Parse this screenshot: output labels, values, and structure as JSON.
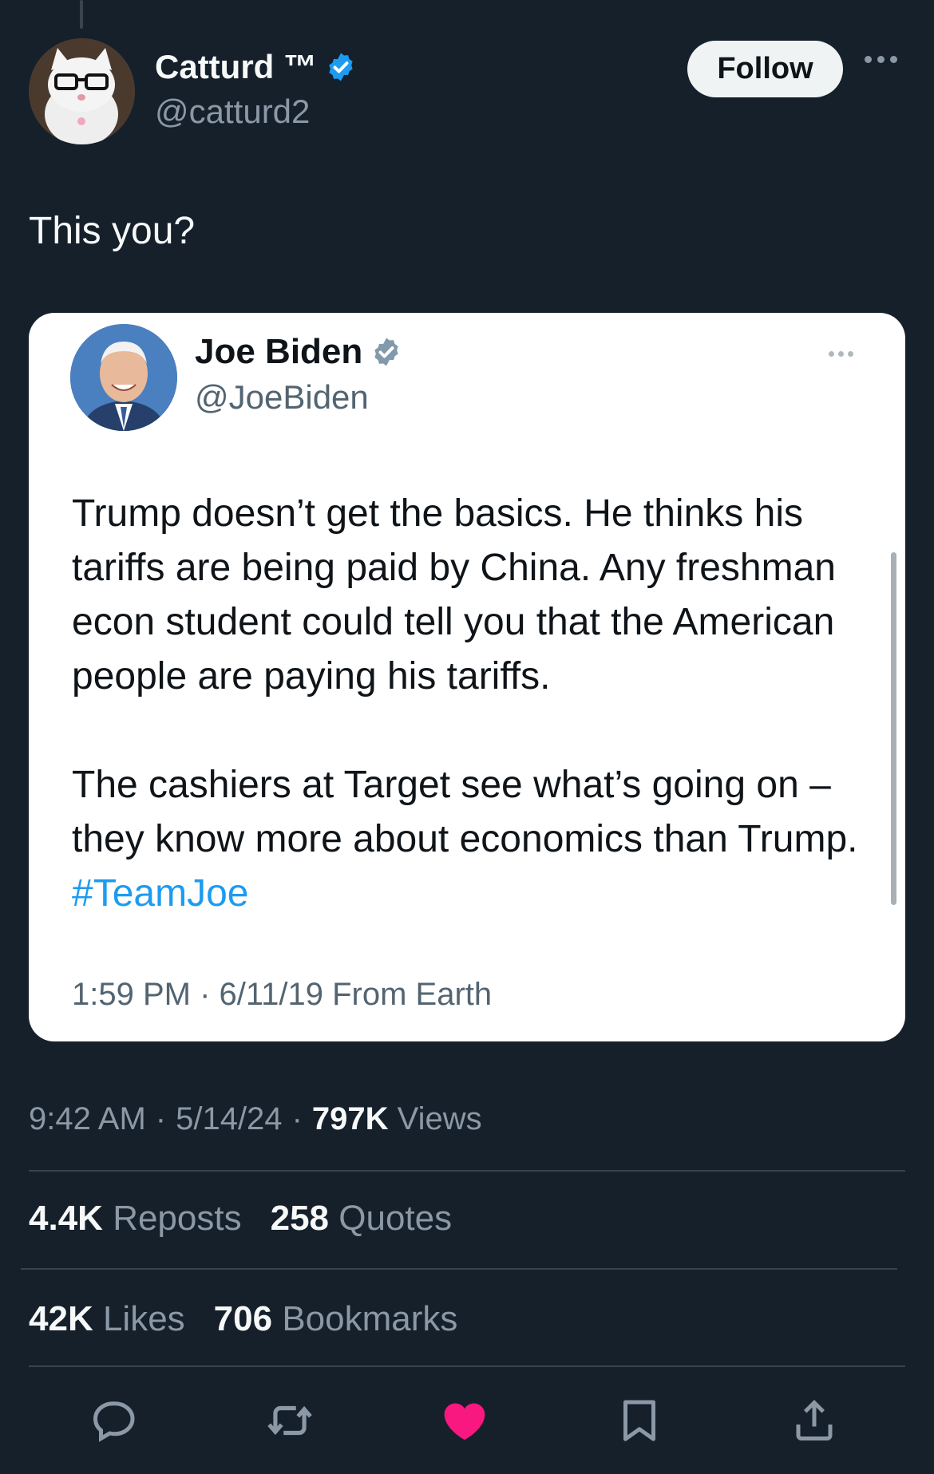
{
  "author": {
    "display_name": "Catturd ™",
    "handle": "@catturd2",
    "verified": true,
    "avatar": "cat-with-glasses-avatar"
  },
  "follow_label": "Follow",
  "tweet_text": "This you?",
  "quoted_tweet": {
    "display_name": "Joe Biden",
    "handle": "@JoeBiden",
    "verified": true,
    "avatar": "man-in-suit-avatar",
    "paragraph1": "Trump doesn’t get the basics. He thinks his tariffs are being paid by China. Any freshman econ student could tell you that the American people are paying his tariffs.",
    "paragraph2_text": "The cashiers at Target see what’s going on – they know more about economics than Trump.",
    "hashtag": "#TeamJoe",
    "meta": "1:59 PM · 6/11/19 From Earth"
  },
  "meta": {
    "time": "9:42 AM",
    "sep1": "·",
    "date": "5/14/24",
    "sep2": "·",
    "views_count": "797K",
    "views_label": "Views"
  },
  "stats": {
    "reposts_count": "4.4K",
    "reposts_label": "Reposts",
    "quotes_count": "258",
    "quotes_label": "Quotes",
    "likes_count": "42K",
    "likes_label": "Likes",
    "bookmarks_count": "706",
    "bookmarks_label": "Bookmarks"
  },
  "actions": [
    {
      "icon": "reply-icon"
    },
    {
      "icon": "repost-icon"
    },
    {
      "icon": "like-icon",
      "active": true
    },
    {
      "icon": "bookmark-icon"
    },
    {
      "icon": "share-icon"
    }
  ],
  "colors": {
    "background": "#15202b",
    "accent": "#1d9bf0",
    "like": "#f91880",
    "muted": "#8b98a5"
  }
}
